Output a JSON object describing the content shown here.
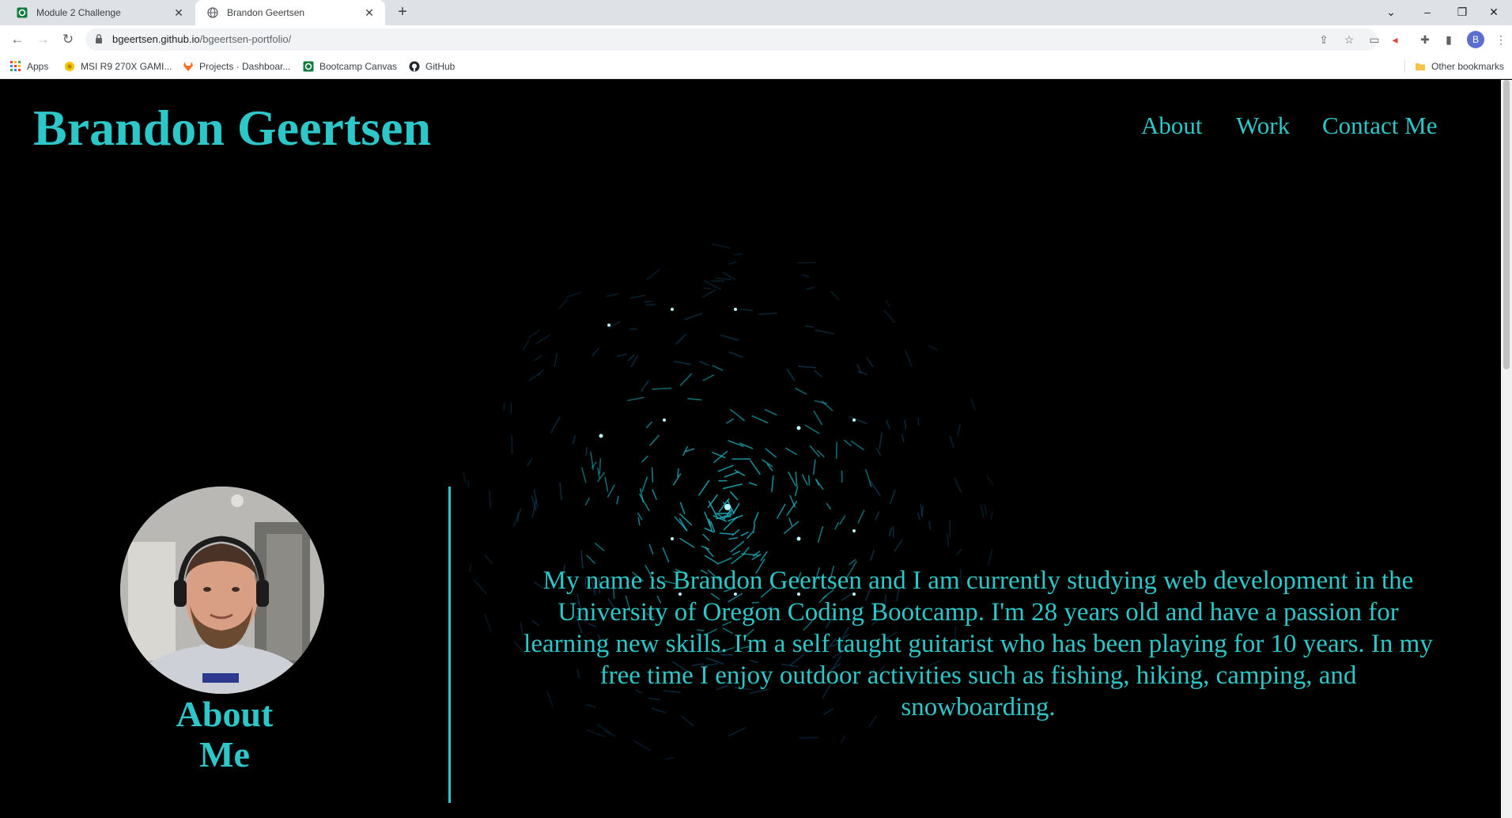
{
  "browser": {
    "tabs": [
      {
        "title": "Module 2 Challenge",
        "favicon": "canvas-icon",
        "active": false
      },
      {
        "title": "Brandon Geertsen",
        "favicon": "globe-icon",
        "active": true
      }
    ],
    "url_host": "bgeertsen.github.io",
    "url_path": "/bgeertsen-portfolio/",
    "profile_initial": "B",
    "bookmarks": [
      {
        "label": "Apps",
        "icon": "apps-grid-icon"
      },
      {
        "label": "MSI R9 270X GAMI...",
        "icon": "msi-icon"
      },
      {
        "label": "Projects · Dashboar...",
        "icon": "gitlab-icon"
      },
      {
        "label": "Bootcamp Canvas",
        "icon": "canvas-icon"
      },
      {
        "label": "GitHub",
        "icon": "github-icon"
      }
    ],
    "other_bookmarks": "Other bookmarks"
  },
  "site": {
    "brand": "Brandon Geertsen",
    "nav": [
      "About",
      "Work",
      "Contact Me"
    ],
    "about_heading_line1": "About",
    "about_heading_line2": "Me",
    "bio": "My name is Brandon Geertsen and I am currently studying web development in the University of Oregon Coding Bootcamp. I'm 28 years old and have a passion for learning new skills. I'm a self taught guitarist who has been playing for 10 years. In my free time I enjoy outdoor activities such as fishing, hiking, camping, and snowboarding."
  },
  "colors": {
    "accent": "#2dc7c9",
    "page_background": "#000000",
    "tabstrip": "#dee1e6"
  }
}
